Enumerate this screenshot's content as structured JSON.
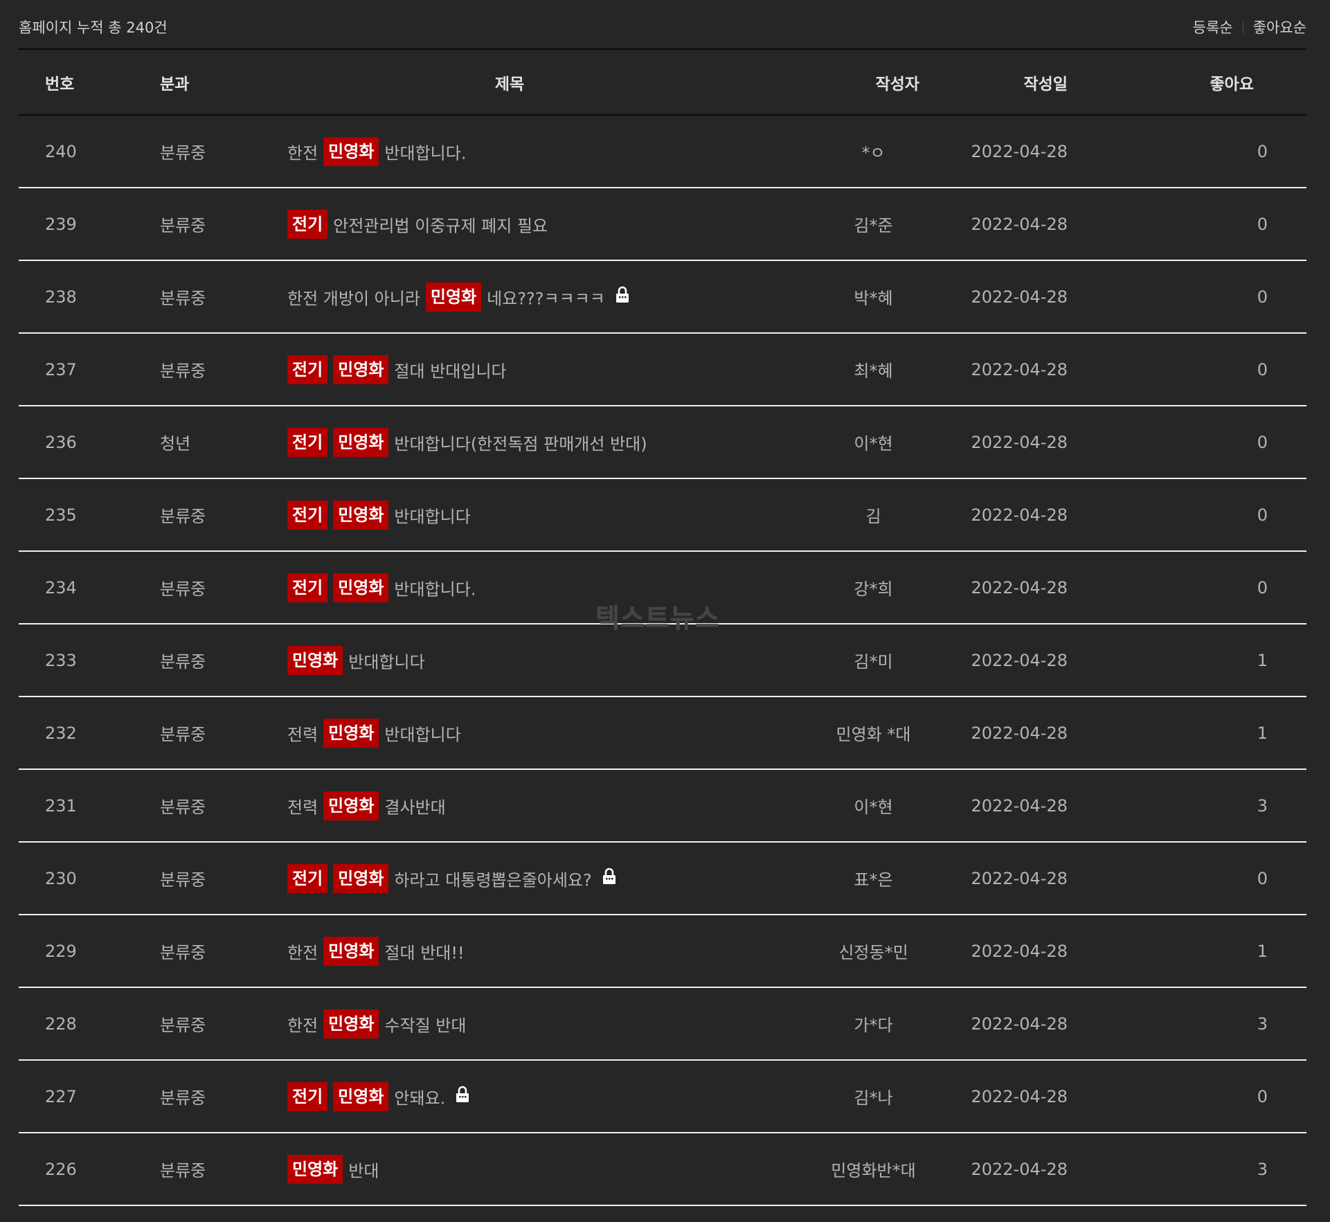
{
  "header": {
    "total_text": "홈페이지 누적 총 240건",
    "sort_options": [
      "등록순",
      "좋아요순"
    ]
  },
  "columns": {
    "no": "번호",
    "category": "분과",
    "title": "제목",
    "author": "작성자",
    "date": "작성일",
    "likes": "좋아요"
  },
  "rows": [
    {
      "no": "240",
      "category": "분류중",
      "title": [
        {
          "t": "text",
          "v": "한전"
        },
        {
          "t": "tag",
          "v": "민영화"
        },
        {
          "t": "text",
          "v": "반대합니다."
        }
      ],
      "locked": false,
      "author": "*ㅇ",
      "date": "2022-04-28",
      "likes": "0"
    },
    {
      "no": "239",
      "category": "분류중",
      "title": [
        {
          "t": "tag",
          "v": "전기"
        },
        {
          "t": "text",
          "v": "안전관리법 이중규제 폐지 필요"
        }
      ],
      "locked": false,
      "author": "김*준",
      "date": "2022-04-28",
      "likes": "0"
    },
    {
      "no": "238",
      "category": "분류중",
      "title": [
        {
          "t": "text",
          "v": "한전 개방이 아니라"
        },
        {
          "t": "tag",
          "v": "민영화"
        },
        {
          "t": "text",
          "v": "네요???ㅋㅋㅋㅋ"
        }
      ],
      "locked": true,
      "author": "박*혜",
      "date": "2022-04-28",
      "likes": "0"
    },
    {
      "no": "237",
      "category": "분류중",
      "title": [
        {
          "t": "tag",
          "v": "전기"
        },
        {
          "t": "tag",
          "v": "민영화"
        },
        {
          "t": "text",
          "v": "절대 반대입니다"
        }
      ],
      "locked": false,
      "author": "최*혜",
      "date": "2022-04-28",
      "likes": "0"
    },
    {
      "no": "236",
      "category": "청년",
      "title": [
        {
          "t": "tag",
          "v": "전기"
        },
        {
          "t": "tag",
          "v": "민영화"
        },
        {
          "t": "text",
          "v": "반대합니다(한전독점 판매개선 반대)"
        }
      ],
      "locked": false,
      "author": "이*현",
      "date": "2022-04-28",
      "likes": "0"
    },
    {
      "no": "235",
      "category": "분류중",
      "title": [
        {
          "t": "tag",
          "v": "전기"
        },
        {
          "t": "tag",
          "v": "민영화"
        },
        {
          "t": "text",
          "v": "반대합니다"
        }
      ],
      "locked": false,
      "author": "김",
      "date": "2022-04-28",
      "likes": "0"
    },
    {
      "no": "234",
      "category": "분류중",
      "title": [
        {
          "t": "tag",
          "v": "전기"
        },
        {
          "t": "tag",
          "v": "민영화"
        },
        {
          "t": "text",
          "v": "반대합니다."
        }
      ],
      "locked": false,
      "author": "강*희",
      "date": "2022-04-28",
      "likes": "0"
    },
    {
      "no": "233",
      "category": "분류중",
      "title": [
        {
          "t": "tag",
          "v": "민영화"
        },
        {
          "t": "text",
          "v": "반대합니다"
        }
      ],
      "locked": false,
      "author": "김*미",
      "date": "2022-04-28",
      "likes": "1"
    },
    {
      "no": "232",
      "category": "분류중",
      "title": [
        {
          "t": "text",
          "v": "전력"
        },
        {
          "t": "tag",
          "v": "민영화"
        },
        {
          "t": "text",
          "v": "반대합니다"
        }
      ],
      "locked": false,
      "author": "민영화 *대",
      "date": "2022-04-28",
      "likes": "1"
    },
    {
      "no": "231",
      "category": "분류중",
      "title": [
        {
          "t": "text",
          "v": "전력"
        },
        {
          "t": "tag",
          "v": "민영화"
        },
        {
          "t": "text",
          "v": "결사반대"
        }
      ],
      "locked": false,
      "author": "이*현",
      "date": "2022-04-28",
      "likes": "3"
    },
    {
      "no": "230",
      "category": "분류중",
      "title": [
        {
          "t": "tag",
          "v": "전기"
        },
        {
          "t": "tag",
          "v": "민영화"
        },
        {
          "t": "text",
          "v": "하라고 대통령뽑은줄아세요?"
        }
      ],
      "locked": true,
      "author": "표*은",
      "date": "2022-04-28",
      "likes": "0"
    },
    {
      "no": "229",
      "category": "분류중",
      "title": [
        {
          "t": "text",
          "v": "한전"
        },
        {
          "t": "tag",
          "v": "민영화"
        },
        {
          "t": "text",
          "v": "절대 반대!!"
        }
      ],
      "locked": false,
      "author": "신정동*민",
      "date": "2022-04-28",
      "likes": "1"
    },
    {
      "no": "228",
      "category": "분류중",
      "title": [
        {
          "t": "text",
          "v": "한전"
        },
        {
          "t": "tag",
          "v": "민영화"
        },
        {
          "t": "text",
          "v": "수작질 반대"
        }
      ],
      "locked": false,
      "author": "가*다",
      "date": "2022-04-28",
      "likes": "3"
    },
    {
      "no": "227",
      "category": "분류중",
      "title": [
        {
          "t": "tag",
          "v": "전기"
        },
        {
          "t": "tag",
          "v": "민영화"
        },
        {
          "t": "text",
          "v": "안돼요."
        }
      ],
      "locked": true,
      "author": "김*나",
      "date": "2022-04-28",
      "likes": "0"
    },
    {
      "no": "226",
      "category": "분류중",
      "title": [
        {
          "t": "tag",
          "v": "민영화"
        },
        {
          "t": "text",
          "v": "반대"
        }
      ],
      "locked": false,
      "author": "민영화반*대",
      "date": "2022-04-28",
      "likes": "3"
    }
  ],
  "watermark": "텍스트뉴스",
  "colors": {
    "background": "#262626",
    "tag": "#b40000",
    "text": "#b4b4b4"
  },
  "icons": {
    "locked": "lock-icon"
  }
}
